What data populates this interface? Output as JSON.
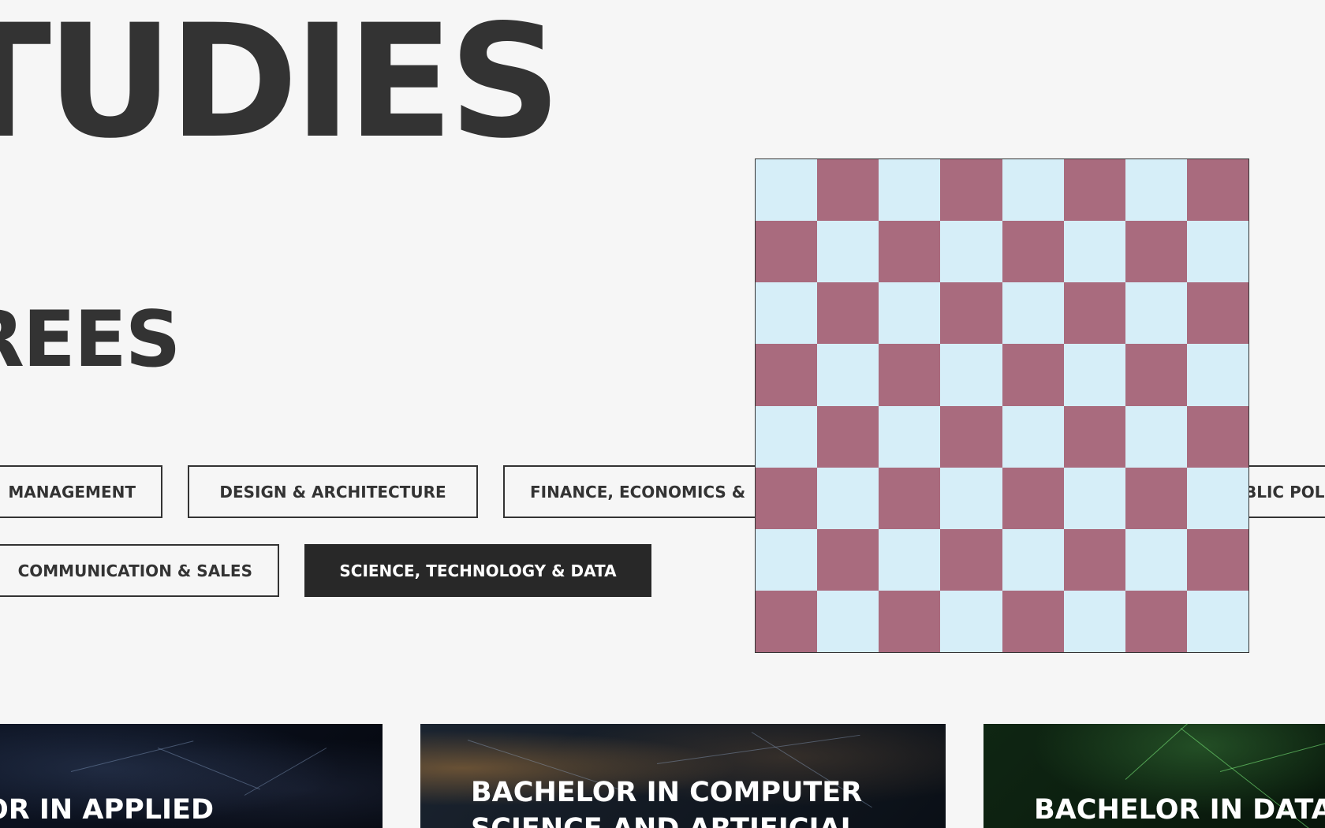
{
  "headings": {
    "studies": "TUDIES",
    "degrees": "GREES"
  },
  "filters": [
    {
      "label": "MANAGEMENT",
      "active": false
    },
    {
      "label": "DESIGN & ARCHITECTURE",
      "active": false
    },
    {
      "label": "FINANCE, ECONOMICS &",
      "active": false
    },
    {
      "label": "BLIC POL",
      "active": false
    },
    {
      "label": "COMMUNICATION & SALES",
      "active": false
    },
    {
      "label": "SCIENCE, TECHNOLOGY & DATA",
      "active": true
    }
  ],
  "chessboard": {
    "rows": 8,
    "cols": 8,
    "light_color": "#d6eef8",
    "dark_color": "#a96b7e"
  },
  "cards": [
    {
      "title": "ELOR IN APPLIED"
    },
    {
      "title": "BACHELOR IN COMPUTER",
      "title_line2": "SCIENCE AND ARTIFICIAL"
    },
    {
      "title": "BACHELOR IN DATA"
    }
  ],
  "colors": {
    "background": "#f6f6f6",
    "text": "#333333",
    "active_button": "#282828"
  }
}
